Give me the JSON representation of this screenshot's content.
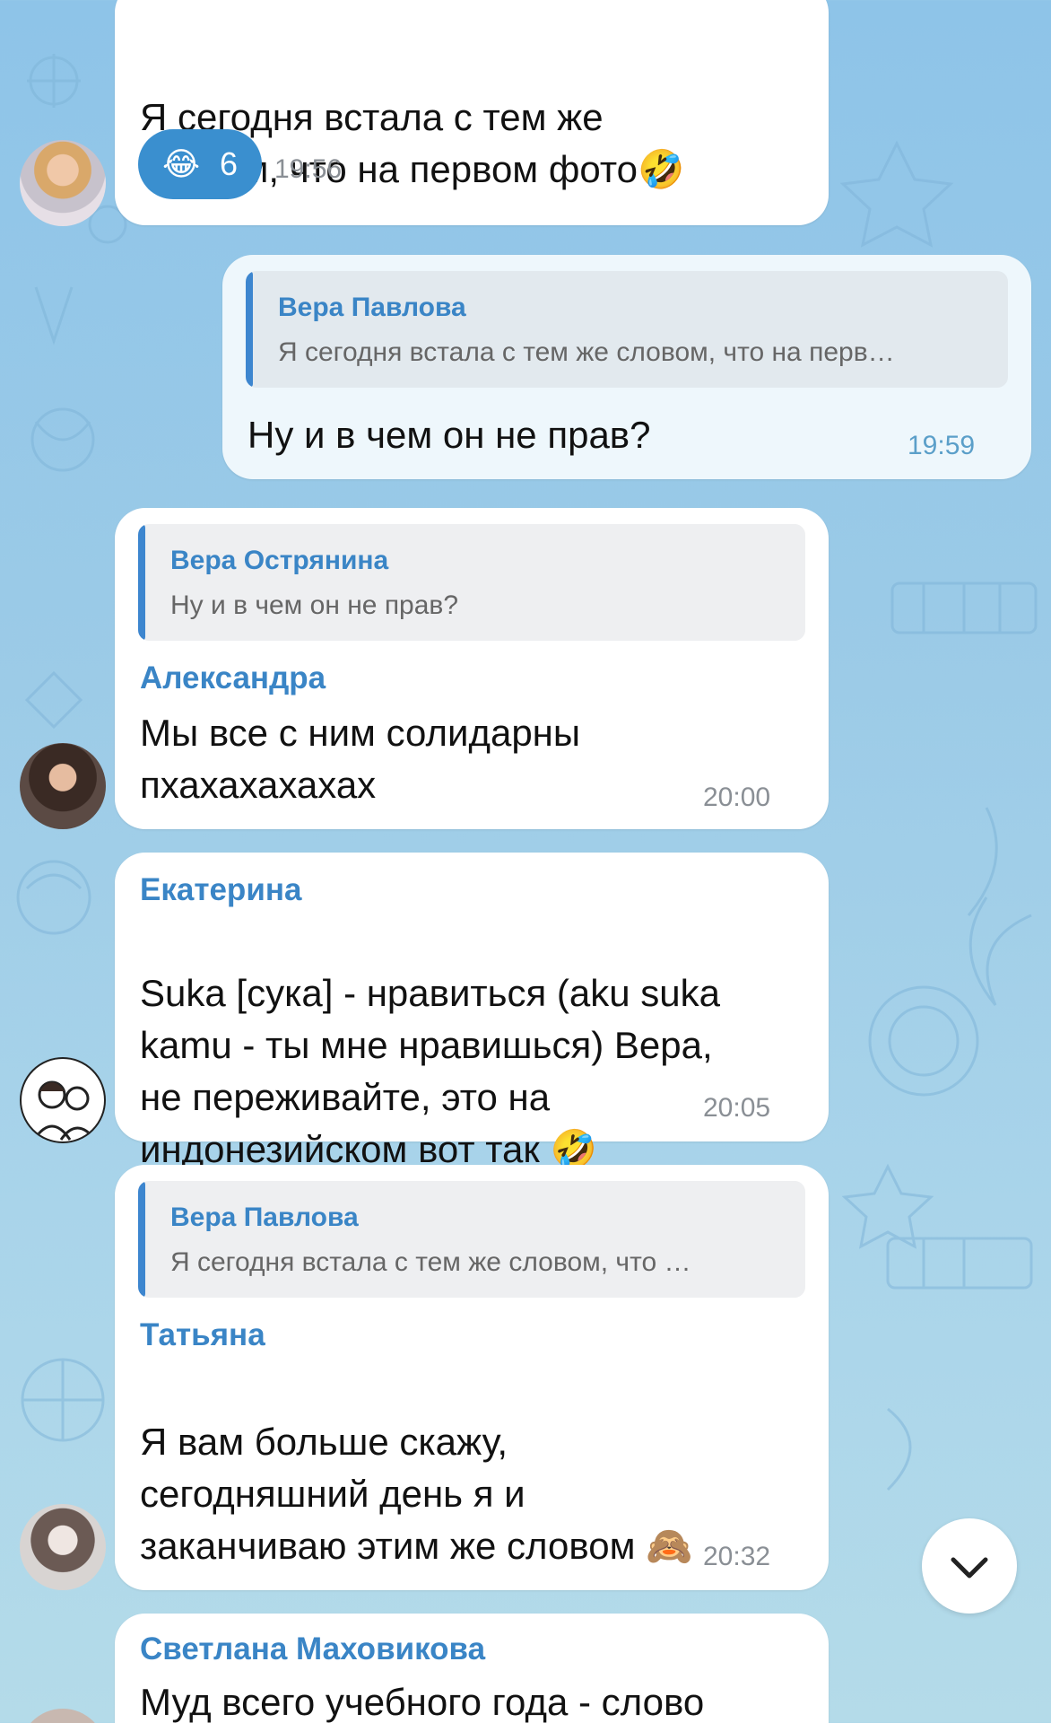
{
  "messages": {
    "m1": {
      "text": "Я сегодня встала с тем же\nсловом, что на первом фото",
      "emoji": "🤣",
      "reaction_emoji": "😂",
      "reaction_count": "6",
      "time": "19:56"
    },
    "m2": {
      "reply_name": "Вера Павлова",
      "reply_text": "Я сегодня встала с тем же словом, что на перв…",
      "text": "Ну и в чем он не прав?",
      "time": "19:59"
    },
    "m3": {
      "reply_name": "Вера Острянина",
      "reply_text": "Ну и в чем он не прав?",
      "sender": "Александра",
      "text": "Мы все с ним солидарны\nпхахахахахах",
      "time": "20:00"
    },
    "m4": {
      "sender": "Екатерина",
      "text": "Suka [сука] - нравиться (aku suka\nkamu - ты мне нравишься) Вера,\nне переживайте, это на\nиндонезийском вот так",
      "emoji": "🤣",
      "time": "20:05"
    },
    "m5": {
      "reply_name": "Вера Павлова",
      "reply_text": "Я сегодня встала с тем же словом, что …",
      "sender": "Татьяна",
      "text": "Я вам больше скажу,\nсегодняшний день я и\nзаканчиваю этим же словом",
      "emoji": "🙈",
      "time": "20:32"
    },
    "m6": {
      "sender": "Светлана Маховикова",
      "text": "Муд всего учебного года - слово"
    }
  },
  "scroll_button": {
    "icon": "chevron-down-icon"
  },
  "colors": {
    "accent": "#3a85c6",
    "reaction": "#3a8fcf",
    "outgoing": "#eef7fc"
  }
}
